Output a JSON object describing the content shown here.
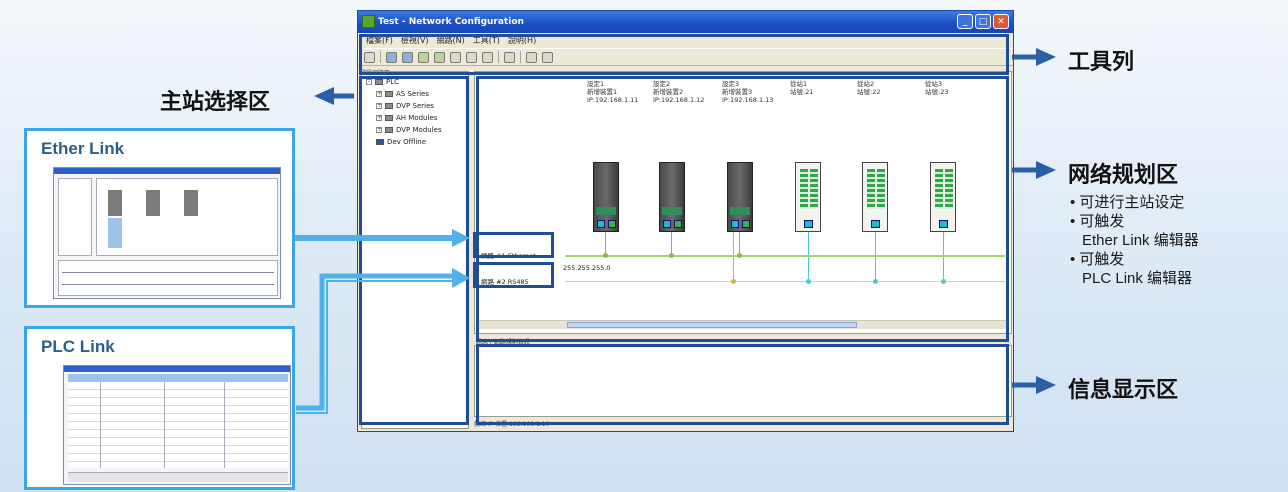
{
  "window": {
    "title": "Test - Network Configuration",
    "menu": [
      "檔案(F)",
      "檢視(V)",
      "網路(N)",
      "工具(T)",
      "說明(H)"
    ],
    "tree_caption": "通訊網路區",
    "tree_items": [
      "PLC",
      "AS Series",
      "DVP Series",
      "AH Modules",
      "DVP Modules",
      "Dev Offline"
    ],
    "devices": [
      {
        "lines": [
          "設定1",
          "新增裝置1",
          "IP:192.168.1.11"
        ]
      },
      {
        "lines": [
          "設定2",
          "新增裝置2",
          "IP:192.168.1.12"
        ]
      },
      {
        "lines": [
          "設定3",
          "新增裝置3",
          "IP:192.168.1.13"
        ]
      },
      {
        "lines": [
          "從站1",
          "站號:21"
        ]
      },
      {
        "lines": [
          "從站2",
          "站號:22"
        ]
      },
      {
        "lines": [
          "從站3",
          "站號:23"
        ]
      }
    ],
    "networks": [
      "網路 #1 Ethernet",
      "網路 #2 RS485"
    ],
    "subnet_label": "255.255.255.0",
    "info_caption": "訊息 / 網路規劃資訊",
    "status_text": "就緒   IP 位置:192.168.1.10"
  },
  "labels": {
    "master_area": "主站选择区",
    "toolbar": "工具列",
    "network_area": "网络规划区",
    "network_bullets": [
      "• 可进行主站设定",
      "• 可触发",
      "Ether Link 编辑器",
      "• 可触发",
      "PLC Link 编辑器"
    ],
    "info_area": "信息显示区"
  },
  "insets": {
    "ether_link": {
      "title": "Ether Link"
    },
    "plc_link": {
      "title": "PLC Link"
    }
  },
  "colors": {
    "highlight": "#1f4e96",
    "inset_border": "#3aa6e6",
    "arrow": "#2b5fa8",
    "connector": "#4fb2ea"
  }
}
